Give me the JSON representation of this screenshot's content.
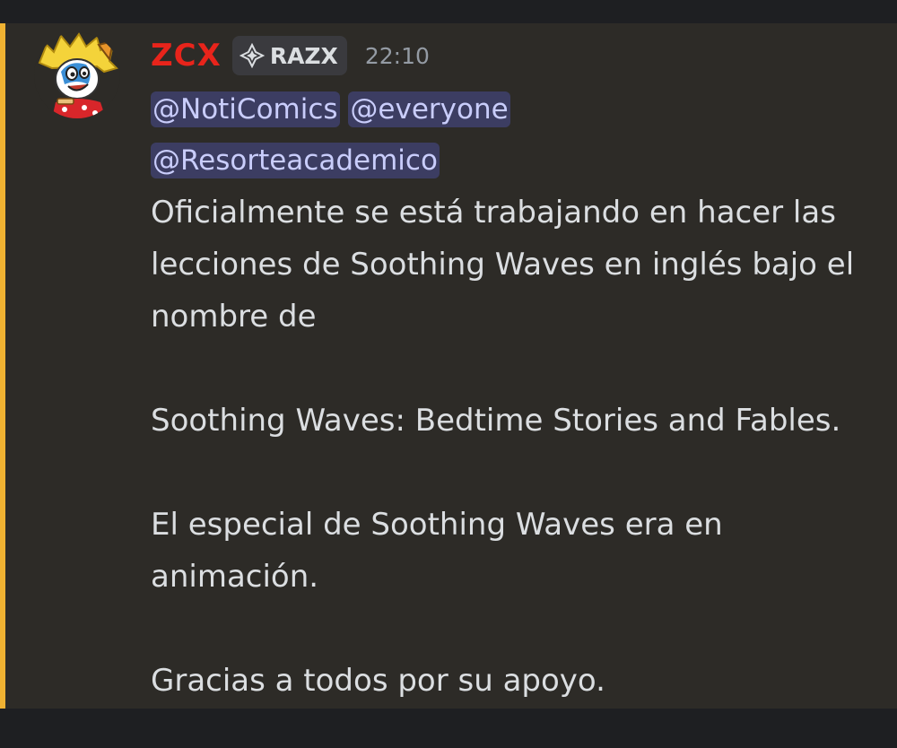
{
  "message": {
    "username": "ZCX",
    "username_color": "#e8241b",
    "clan_tag": "RAZX",
    "timestamp": "22:10",
    "accent_bar_color": "#f0b232",
    "mentions": [
      "@NotiComics",
      "@everyone",
      "@Resorteacademico"
    ],
    "paragraphs": [
      "Oficialmente se está trabajando en hacer las lecciones de Soothing Waves en inglés bajo el nombre de",
      "Soothing Waves: Bedtime Stories and Fables.",
      "El especial de Soothing Waves era en animación.",
      "Gracias a todos por su apoyo."
    ]
  },
  "icons": {
    "avatar": "cartoon-avatar",
    "clan_badge": "diamond-badge-icon"
  }
}
